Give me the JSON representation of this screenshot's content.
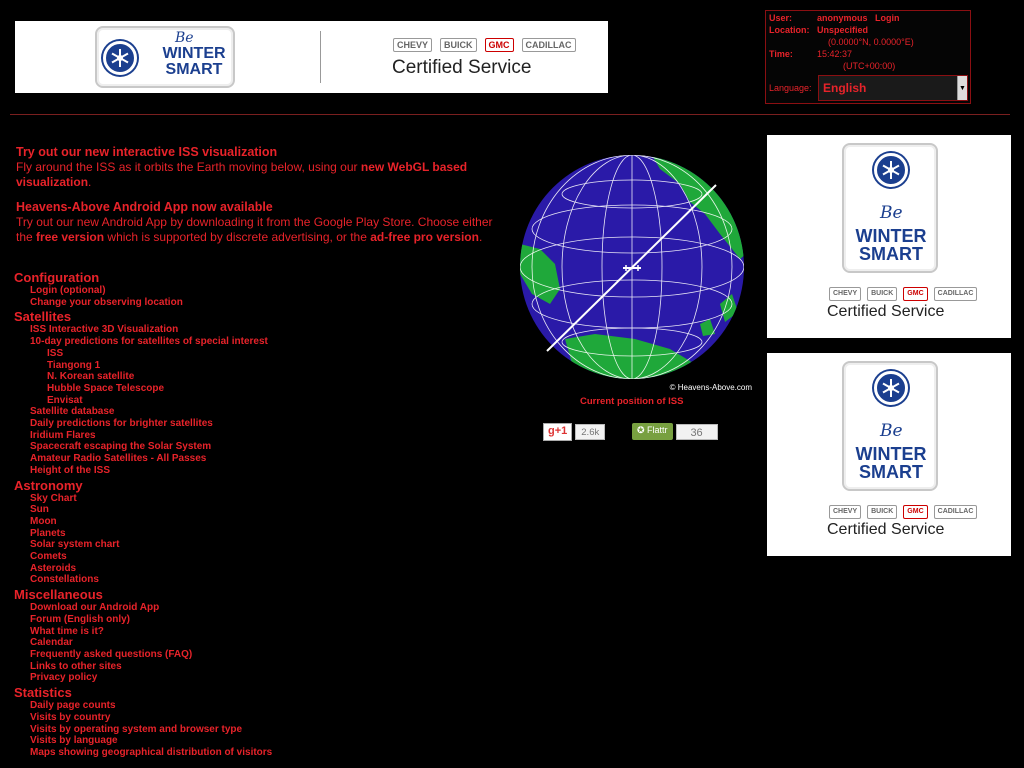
{
  "banner_ad": {
    "be": "Be",
    "winter_smart": "WINTER SMART",
    "certified": "Certified Service",
    "brands": [
      "CHEVY",
      "BUICK",
      "GMC",
      "CADILLAC"
    ]
  },
  "user_box": {
    "user_label": "User:",
    "user_value": "anonymous",
    "login_link": "Login",
    "location_label": "Location:",
    "location_value": "Unspecified",
    "coordinates": "(0.0000°N, 0.0000°E)",
    "time_label": "Time:",
    "time_value": "15:42:37",
    "timezone": "(UTC+00:00)",
    "language_label": "Language:",
    "language_value": "English"
  },
  "news": {
    "iss_heading": "Try out our new interactive ISS visualization",
    "iss_text": "Fly around the ISS as it orbits the Earth moving below, using our",
    "iss_link": "new WebGL based visualization",
    "iss_end": ".",
    "app_heading": "Heavens-Above Android App now available",
    "app_text1": "Try out our new Android App by downloading it from the Google Play Store. Choose either the",
    "app_free": "free version",
    "app_text2": "which is supported by discrete advertising, or the",
    "app_pro": "ad-free pro version",
    "app_end": "."
  },
  "menu": {
    "configuration": "Configuration",
    "config_items": [
      "Login (optional)",
      "Change your observing location"
    ],
    "satellites": "Satellites",
    "sat_items_a": [
      "ISS Interactive 3D Visualization",
      "10-day predictions for satellites of special interest"
    ],
    "sat_sub_items": [
      "ISS",
      "Tiangong 1",
      "N. Korean satellite",
      "Hubble Space Telescope",
      "Envisat"
    ],
    "sat_items_b": [
      "Satellite database",
      "Daily predictions for brighter satellites",
      "Iridium Flares",
      "Spacecraft escaping the Solar System",
      "Amateur Radio Satellites - All Passes",
      "Height of the ISS"
    ],
    "astronomy": "Astronomy",
    "astro_items": [
      "Sky Chart",
      "Sun",
      "Moon",
      "Planets",
      "Solar system chart",
      "Comets",
      "Asteroids",
      "Constellations"
    ],
    "miscellaneous": "Miscellaneous",
    "misc_items": [
      "Download our Android App",
      "Forum (English only)",
      "What time is it?",
      "Calendar",
      "Frequently asked questions (FAQ)",
      "Links to other sites",
      "Privacy policy"
    ],
    "statistics": "Statistics",
    "stats_items": [
      "Daily page counts",
      "Visits by country",
      "Visits by operating system and browser type",
      "Visits by language",
      "Maps showing geographical distribution of visitors"
    ]
  },
  "globe": {
    "credit": "© Heavens-Above.com",
    "caption": "Current position of ISS"
  },
  "social": {
    "gplus_label": "g+1",
    "gplus_count": "2.6k",
    "flattr_label": "Flattr",
    "flattr_count": "36"
  },
  "colors": {
    "accent": "#e8232a",
    "background": "#000000",
    "ocean": "#2a1aa8",
    "land": "#1fa83a"
  }
}
